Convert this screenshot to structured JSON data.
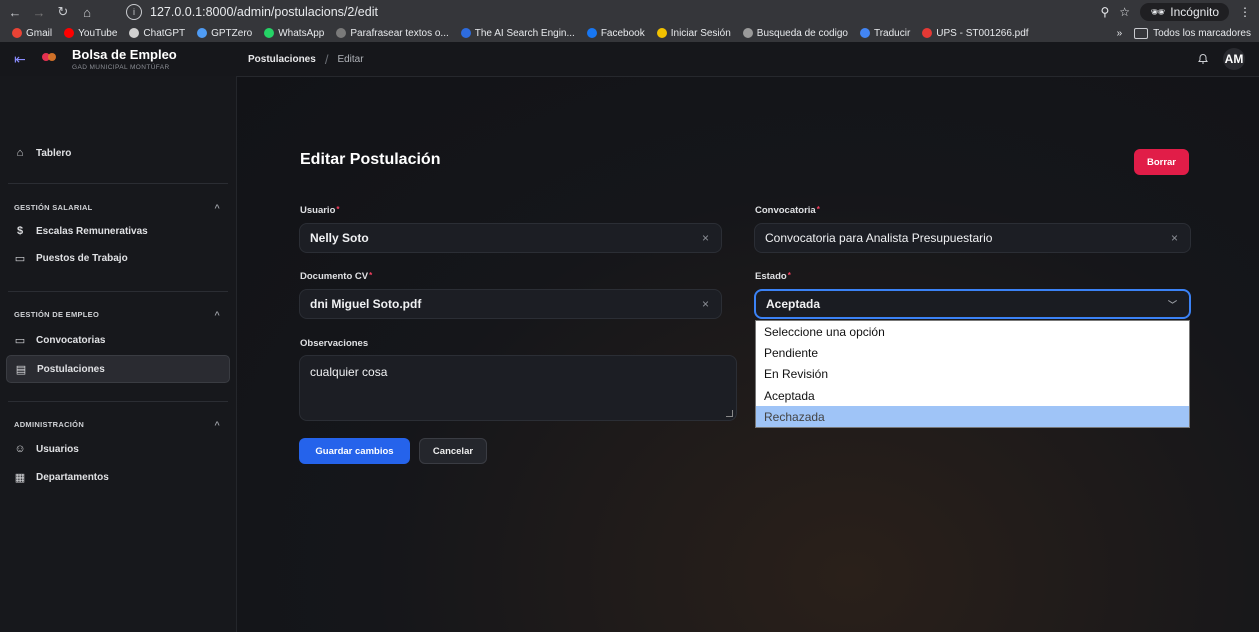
{
  "browser": {
    "url": "127.0.0.1:8000/admin/postulacions/2/edit",
    "incognito_label": "Incógnito",
    "bookmarks": [
      {
        "label": "Gmail",
        "color": "#ea4335"
      },
      {
        "label": "YouTube",
        "color": "#ff0000"
      },
      {
        "label": "ChatGPT",
        "color": "#d0d0d0"
      },
      {
        "label": "GPTZero",
        "color": "#4f9cf5"
      },
      {
        "label": "WhatsApp",
        "color": "#25d366"
      },
      {
        "label": "Parafrasear textos o...",
        "color": "#7a7a7a"
      },
      {
        "label": "The AI Search Engin...",
        "color": "#2d6cdf"
      },
      {
        "label": "Facebook",
        "color": "#1877f2"
      },
      {
        "label": "Iniciar Sesión",
        "color": "#f2c200"
      },
      {
        "label": "Busqueda de codigo",
        "color": "#9a9a9a"
      },
      {
        "label": "Traducir",
        "color": "#4285f4"
      },
      {
        "label": "UPS - ST001266.pdf",
        "color": "#e53935"
      }
    ],
    "more_label": "»",
    "all_bookmarks_label": "Todos los marcadores"
  },
  "app": {
    "brand_title": "Bolsa de Empleo",
    "brand_subtitle": "GAD MUNICIPAL MONTÚFAR",
    "avatar_initials": "AM"
  },
  "breadcrumb": {
    "parent": "Postulaciones",
    "separator": "/",
    "current": "Editar"
  },
  "sidebar": {
    "dashboard": "Tablero",
    "groups": [
      {
        "title": "GESTIÓN SALARIAL",
        "items": [
          "Escalas Remunerativas",
          "Puestos de Trabajo"
        ]
      },
      {
        "title": "GESTIÓN DE EMPLEO",
        "items": [
          "Convocatorias",
          "Postulaciones"
        ]
      },
      {
        "title": "ADMINISTRACIÓN",
        "items": [
          "Usuarios",
          "Departamentos"
        ]
      }
    ],
    "chevron": "^"
  },
  "form": {
    "title": "Editar Postulación",
    "delete_label": "Borrar",
    "required_mark": "*",
    "usuario": {
      "label": "Usuario",
      "value": "Nelly Soto"
    },
    "convocatoria": {
      "label": "Convocatoria",
      "value": "Convocatoria para Analista Presupuestario"
    },
    "documento": {
      "label": "Documento CV",
      "value": "dni Miguel Soto.pdf"
    },
    "estado": {
      "label": "Estado",
      "value": "Aceptada",
      "options": [
        "Seleccione una opción",
        "Pendiente",
        "En Revisión",
        "Aceptada",
        "Rechazada"
      ],
      "highlighted": "Rechazada"
    },
    "observaciones": {
      "label": "Observaciones",
      "value": "cualquier cosa"
    },
    "save_label": "Guardar cambios",
    "cancel_label": "Cancelar",
    "clear_glyph": "×"
  },
  "colors": {
    "primary": "#2563eb",
    "danger": "#e11d48",
    "focus": "#3b82f6"
  }
}
